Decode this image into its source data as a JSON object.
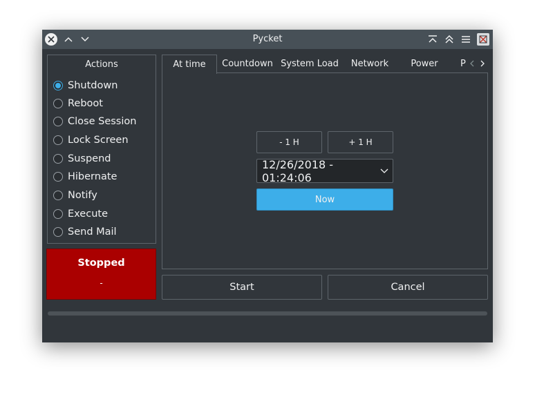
{
  "window": {
    "title": "Pycket"
  },
  "actions": {
    "title": "Actions",
    "items": [
      {
        "label": "Shutdown",
        "checked": true
      },
      {
        "label": "Reboot",
        "checked": false
      },
      {
        "label": "Close Session",
        "checked": false
      },
      {
        "label": "Lock Screen",
        "checked": false
      },
      {
        "label": "Suspend",
        "checked": false
      },
      {
        "label": "Hibernate",
        "checked": false
      },
      {
        "label": "Notify",
        "checked": false
      },
      {
        "label": "Execute",
        "checked": false
      },
      {
        "label": "Send Mail",
        "checked": false
      }
    ]
  },
  "status": {
    "title": "Stopped",
    "value": "-",
    "color": "#aa0000"
  },
  "tabs": [
    {
      "label": "At time",
      "active": true
    },
    {
      "label": "Countdown",
      "active": false
    },
    {
      "label": "System Load",
      "active": false
    },
    {
      "label": "Network",
      "active": false
    },
    {
      "label": "Power",
      "active": false
    },
    {
      "label": "P",
      "active": false
    }
  ],
  "at_time": {
    "minus_label": "- 1 H",
    "plus_label": "+ 1 H",
    "datetime": "12/26/2018 - 01:24:06",
    "now_label": "Now"
  },
  "buttons": {
    "start": "Start",
    "cancel": "Cancel"
  },
  "progress": {
    "value": 0
  },
  "colors": {
    "accent": "#3daee9",
    "background": "#31363b",
    "titlebar": "#475057"
  }
}
